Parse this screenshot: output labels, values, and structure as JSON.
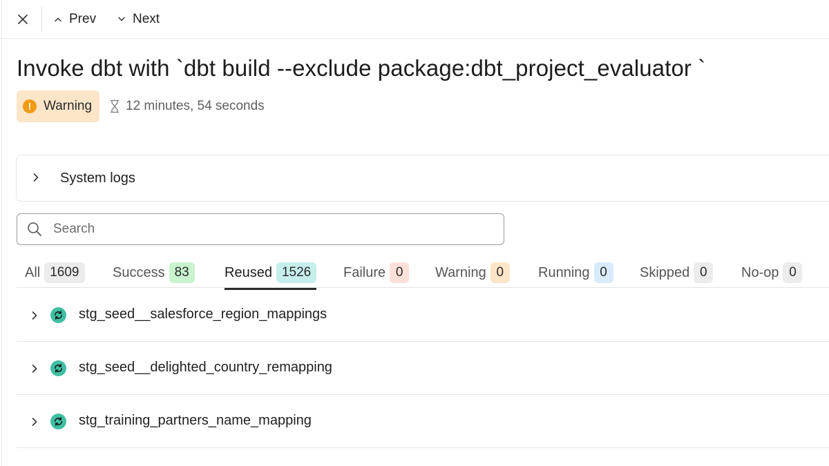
{
  "topbar": {
    "close_icon": "close-icon",
    "prev_label": "Prev",
    "next_label": "Next"
  },
  "run": {
    "title": "Invoke dbt with `dbt build --exclude package:dbt_project_evaluator `",
    "status": "Warning",
    "duration": "12 minutes, 54 seconds"
  },
  "system_logs": {
    "label": "System logs"
  },
  "search": {
    "placeholder": "Search",
    "value": ""
  },
  "tabs": [
    {
      "label": "All",
      "count": "1609",
      "count_bg": "#ececec"
    },
    {
      "label": "Success",
      "count": "83",
      "count_bg": "#c9f2cf"
    },
    {
      "label": "Reused",
      "count": "1526",
      "count_bg": "#c6efeb"
    },
    {
      "label": "Failure",
      "count": "0",
      "count_bg": "#fde0d9"
    },
    {
      "label": "Warning",
      "count": "0",
      "count_bg": "#fde5c8"
    },
    {
      "label": "Running",
      "count": "0",
      "count_bg": "#d9ebfb"
    },
    {
      "label": "Skipped",
      "count": "0",
      "count_bg": "#ececec"
    },
    {
      "label": "No-op",
      "count": "0",
      "count_bg": "#ececec"
    }
  ],
  "active_tab": "Reused",
  "items": [
    {
      "name": "stg_seed__salesforce_region_mappings",
      "status_icon": "reused-icon"
    },
    {
      "name": "stg_seed__delighted_country_remapping",
      "status_icon": "reused-icon"
    },
    {
      "name": "stg_training_partners_name_mapping",
      "status_icon": "reused-icon"
    }
  ],
  "colors": {
    "warning_badge_bg": "#fde5c8",
    "warning_icon": "#f29b16",
    "reused_icon": "#3fbfa2"
  }
}
